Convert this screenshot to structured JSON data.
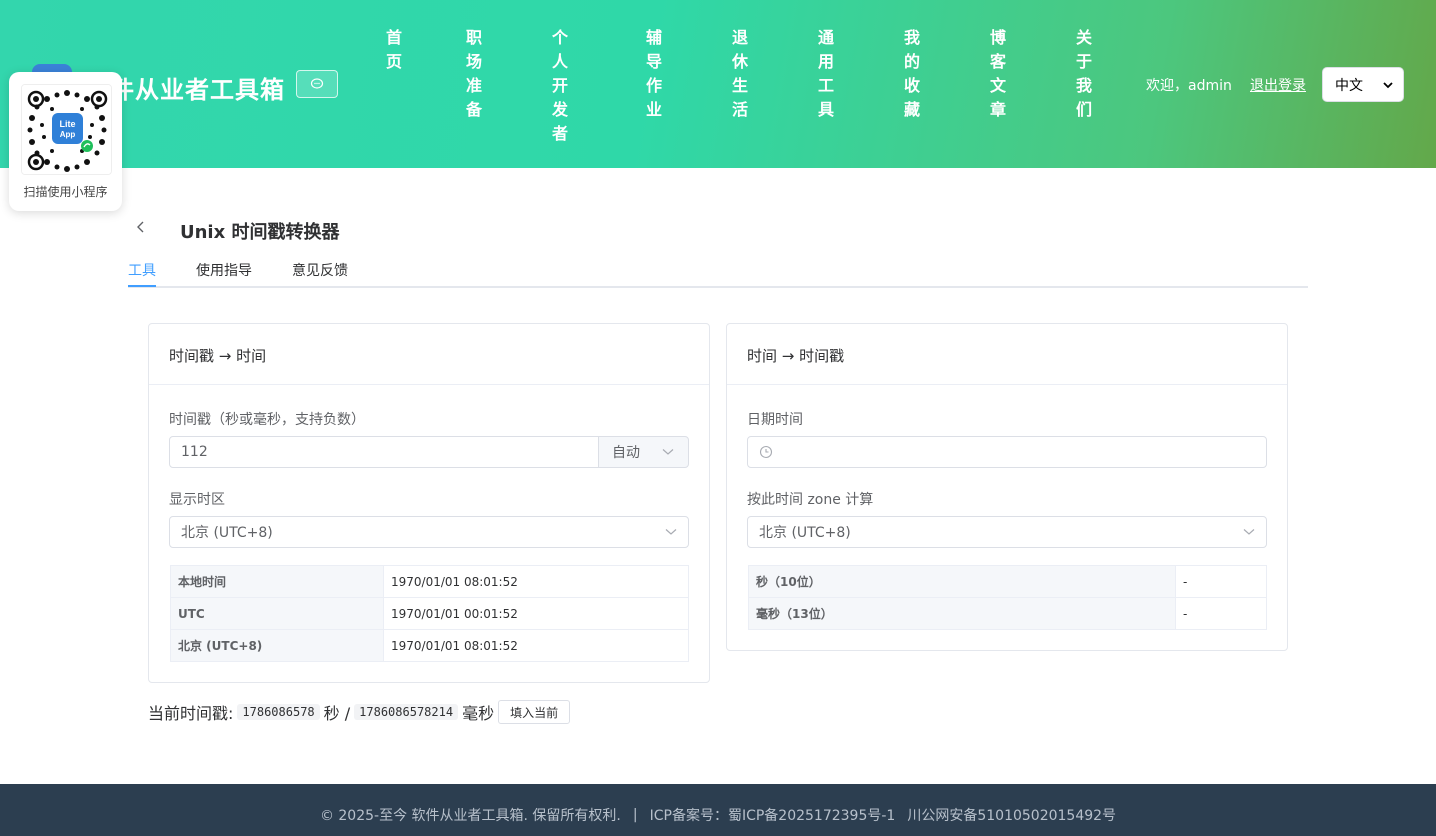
{
  "header": {
    "site_title": "件从业者工具箱",
    "chat_icon": "chat-bubble-icon",
    "nav": [
      {
        "label": "首页"
      },
      {
        "label": "职场准备"
      },
      {
        "label": "个人开发者"
      },
      {
        "label": "辅导作业"
      },
      {
        "label": "退休生活"
      },
      {
        "label": "通用工具"
      },
      {
        "label": "我的收藏"
      },
      {
        "label": "博客文章"
      },
      {
        "label": "关于我们"
      }
    ],
    "welcome": "欢迎，admin",
    "logout": "退出登录",
    "language": "中文"
  },
  "qr": {
    "caption": "扫描使用小程序",
    "badge_line1": "Lite",
    "badge_line2": "App"
  },
  "page": {
    "title": "Unix 时间戳转换器",
    "tabs": [
      {
        "label": "工具",
        "active": true
      },
      {
        "label": "使用指导",
        "active": false
      },
      {
        "label": "意见反馈",
        "active": false
      }
    ]
  },
  "left_card": {
    "title": "时间戳 → 时间",
    "ts_label": "时间戳（秒或毫秒，支持负数）",
    "ts_value": "112",
    "unit_select": "自动",
    "tz_label": "显示时区",
    "tz_value": "北京 (UTC+8)",
    "rows": [
      {
        "k": "本地时间",
        "v": "1970/01/01 08:01:52"
      },
      {
        "k": "UTC",
        "v": "1970/01/01 00:01:52"
      },
      {
        "k": "北京 (UTC+8)",
        "v": "1970/01/01 08:01:52"
      }
    ]
  },
  "right_card": {
    "title": "时间 → 时间戳",
    "dt_label": "日期时间",
    "dt_value": "",
    "tz_label": "按此时间 zone 计算",
    "tz_value": "北京 (UTC+8)",
    "rows": [
      {
        "k": "秒（10位）",
        "v": "-"
      },
      {
        "k": "毫秒（13位）",
        "v": "-"
      }
    ]
  },
  "now": {
    "label": "当前时间戳:",
    "seconds": "1786086578",
    "sec_unit": "秒 /",
    "millis": "1786086578214",
    "ms_unit": "毫秒",
    "fill_button": "填入当前"
  },
  "footer": {
    "copyright": "© 2025-至今 软件从业者工具箱. 保留所有权利.",
    "sep": "|",
    "icp": "ICP备案号：蜀ICP备2025172395号-1",
    "police": "川公网安备51010502015492号"
  }
}
